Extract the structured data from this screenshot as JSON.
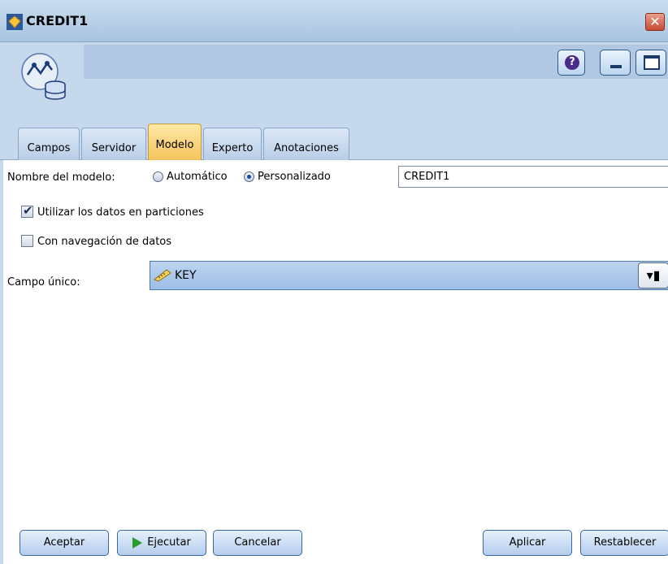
{
  "window": {
    "title": "CREDIT1",
    "close_glyph": "✕"
  },
  "header": {
    "help_glyph": "?",
    "node_icon": "model-node-icon"
  },
  "tabs": [
    {
      "label": "Campos"
    },
    {
      "label": "Servidor"
    },
    {
      "label": "Modelo",
      "active": true
    },
    {
      "label": "Experto"
    },
    {
      "label": "Anotaciones"
    }
  ],
  "form": {
    "model_name_label": "Nombre del modelo:",
    "radio_auto": "Automático",
    "radio_custom": "Personalizado",
    "model_name_value": "CREDIT1",
    "use_partitions": "Utilizar los datos en particiones",
    "use_partitions_checked": true,
    "drilldown": "Con navegación de datos",
    "drilldown_checked": false,
    "unique_field_label": "Campo único:",
    "unique_field_value": "KEY"
  },
  "buttons": {
    "ok": "Aceptar",
    "run": "Ejecutar",
    "cancel": "Cancelar",
    "apply": "Aplicar",
    "reset": "Restablecer"
  },
  "colors": {
    "active_tab": "#f5c25a",
    "header_bg": "#c5d8ec",
    "select_bg": "#9dbde6"
  }
}
